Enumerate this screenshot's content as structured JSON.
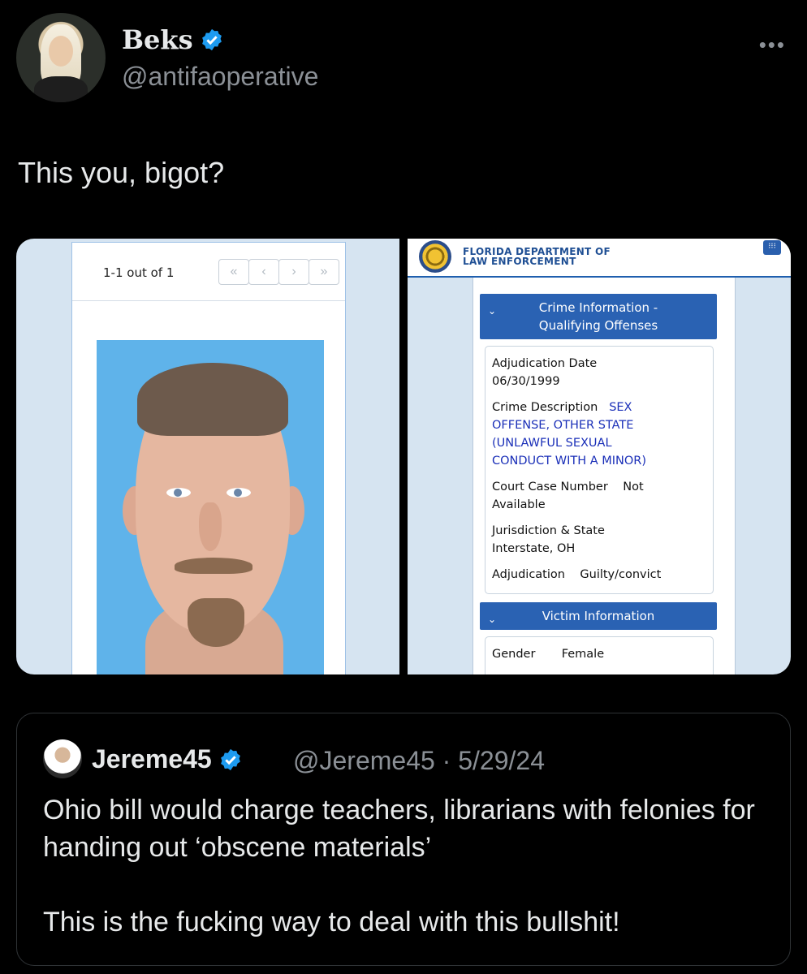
{
  "tweet": {
    "author_name": "Beks",
    "author_handle": "@antifaoperative",
    "more_label": "•••",
    "text": "This you, bigot?"
  },
  "media_left": {
    "pager_count": "1-1 out of 1",
    "pager_buttons": [
      "«",
      "‹",
      "›",
      "»"
    ]
  },
  "media_right": {
    "agency_line1": "FLORIDA DEPARTMENT OF",
    "agency_line2": "LAW ENFORCEMENT",
    "crime_section_line1": "Crime Information -",
    "crime_section_line2": "Qualifying Offenses",
    "adjudication_date_label": "Adjudication Date",
    "adjudication_date_value": "06/30/1999",
    "crime_description_label": "Crime Description",
    "crime_description_value_1": "SEX",
    "crime_description_value_2": "OFFENSE, OTHER STATE",
    "crime_description_value_3": "(UNLAWFUL SEXUAL",
    "crime_description_value_4": "CONDUCT WITH A MINOR)",
    "court_case_label": "Court Case Number",
    "court_case_value_1": "Not",
    "court_case_value_2": "Available",
    "jurisdiction_label": "Jurisdiction & State",
    "jurisdiction_value": "Interstate, OH",
    "adjudication_label": "Adjudication",
    "adjudication_value": "Guilty/convict",
    "victim_section": "Victim Information",
    "gender_label": "Gender",
    "gender_value": "Female"
  },
  "quoted": {
    "author_name": "Jereme45",
    "meta": "@Jereme45 · 5/29/24",
    "text_1": "Ohio bill would charge teachers, librarians with felonies for handing out ‘obscene materials’",
    "text_2": "This is the fucking way to deal with this bullshit!"
  },
  "colors": {
    "verified": "#1d9bf0",
    "background": "#000000",
    "fdle_blue": "#2a62b3"
  },
  "icons": [
    "verified-badge-icon",
    "more-icon",
    "chevron-down-icon",
    "grid-menu-icon"
  ]
}
